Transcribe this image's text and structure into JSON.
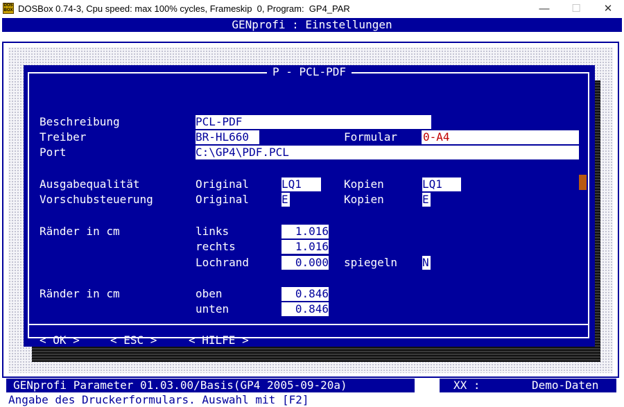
{
  "window": {
    "app_icon_text": "DOS BOX",
    "title": "DOSBox 0.74-3, Cpu speed: max 100% cycles, Frameskip  0, Program:  GP4_PAR",
    "minimize": "—",
    "maximize": "☐",
    "close": "✕"
  },
  "screen": {
    "header": "GENprofi : Einstellungen",
    "dialog_title": "P - PCL-PDF",
    "labels": {
      "beschreibung": "Beschreibung",
      "treiber": "Treiber",
      "port": "Port",
      "formular": "Formular",
      "ausgabequalitaet": "Ausgabequalität",
      "vorschubsteuerung": "Vorschubsteuerung",
      "raender1": "Ränder in cm",
      "raender2": "Ränder in cm",
      "original1": "Original",
      "original2": "Original",
      "kopien1": "Kopien",
      "kopien2": "Kopien",
      "links": "links",
      "rechts": "rechts",
      "lochrand": "Lochrand",
      "spiegeln": "spiegeln",
      "oben": "oben",
      "unten": "unten"
    },
    "fields": {
      "beschreibung": "PCL-PDF",
      "treiber": "BR-HL660",
      "formular": "0-A4",
      "port": "C:\\GP4\\PDF.PCL",
      "qual_original": "LQ1",
      "qual_kopien": "LQ1",
      "vorschub_original": "E",
      "vorschub_kopien": "E",
      "links": "1.016",
      "rechts": "1.016",
      "lochrand": "0.000",
      "spiegeln": "N",
      "oben": "0.846",
      "unten": "0.846"
    },
    "buttons": {
      "ok": "< OK >",
      "esc": "< ESC >",
      "hilfe": "< HILFE >"
    },
    "status": {
      "left": "GENprofi Parameter 01.03.00/Basis(GP4 2005-09-20a)",
      "middle": "XX :",
      "right": "Demo-Daten"
    },
    "hint": "Angabe des Druckerformulars. Auswahl mit [F2]"
  }
}
